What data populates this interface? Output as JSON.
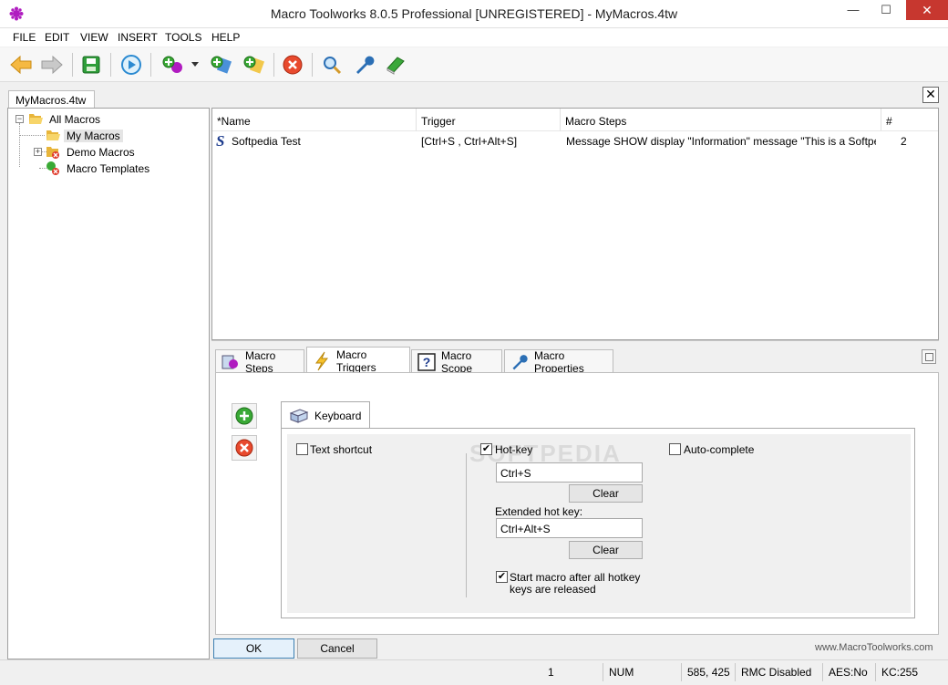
{
  "window": {
    "title": "Macro Toolworks 8.0.5 Professional [UNREGISTERED] - MyMacros.4tw",
    "minimize": "—",
    "maximize": "☐",
    "close": "✕"
  },
  "menu": [
    "FILE",
    "EDIT",
    "VIEW",
    "INSERT",
    "TOOLS",
    "HELP"
  ],
  "toolbar": {
    "icons": [
      "back-arrow-icon",
      "forward-arrow-icon",
      "save-icon",
      "play-icon",
      "new-macro-icon",
      "new-macro-dropdown",
      "add-folder-icon",
      "add-template-icon",
      "delete-icon",
      "search-icon",
      "settings-wrench-icon",
      "help-book-icon"
    ]
  },
  "document_tab": "MyMacros.4tw",
  "tree": {
    "items": [
      {
        "label": "All Macros",
        "expander": "⊟"
      },
      {
        "label": "My Macros"
      },
      {
        "label": "Demo Macros",
        "expander": "⊞"
      },
      {
        "label": "Macro Templates"
      }
    ]
  },
  "list": {
    "columns": [
      "*Name",
      "Trigger",
      "Macro Steps",
      "#"
    ],
    "rows": [
      {
        "name": "Softpedia Test",
        "trigger": "[Ctrl+S , Ctrl+Alt+S]",
        "steps": "Message SHOW display \"Information\" message \"This is a Softpedia t...",
        "count": "2"
      }
    ]
  },
  "panel_tabs": [
    "Macro Steps",
    "Macro Triggers",
    "Macro Scope",
    "Macro Properties"
  ],
  "trigger_tab": {
    "keyboard_tab": "Keyboard",
    "text_shortcut": {
      "label": "Text shortcut",
      "checked": false
    },
    "hot_key": {
      "label": "Hot-key",
      "checked": true,
      "value": "Ctrl+S",
      "clear": "Clear"
    },
    "extended": {
      "label": "Extended hot key:",
      "value": "Ctrl+Alt+S",
      "clear": "Clear"
    },
    "start_after_release": {
      "label_1": "Start macro after all hotkey",
      "label_2": "keys are released",
      "checked": true
    },
    "auto_complete": {
      "label": "Auto-complete",
      "checked": false
    }
  },
  "buttons": {
    "ok": "OK",
    "cancel": "Cancel"
  },
  "website": "www.MacroToolworks.com",
  "watermark": "SOFTPEDIA",
  "status": {
    "count": "1",
    "num": "NUM",
    "coords": "585, 425",
    "rmc": "RMC Disabled",
    "aes": "AES:No",
    "kc": "KC:255"
  }
}
